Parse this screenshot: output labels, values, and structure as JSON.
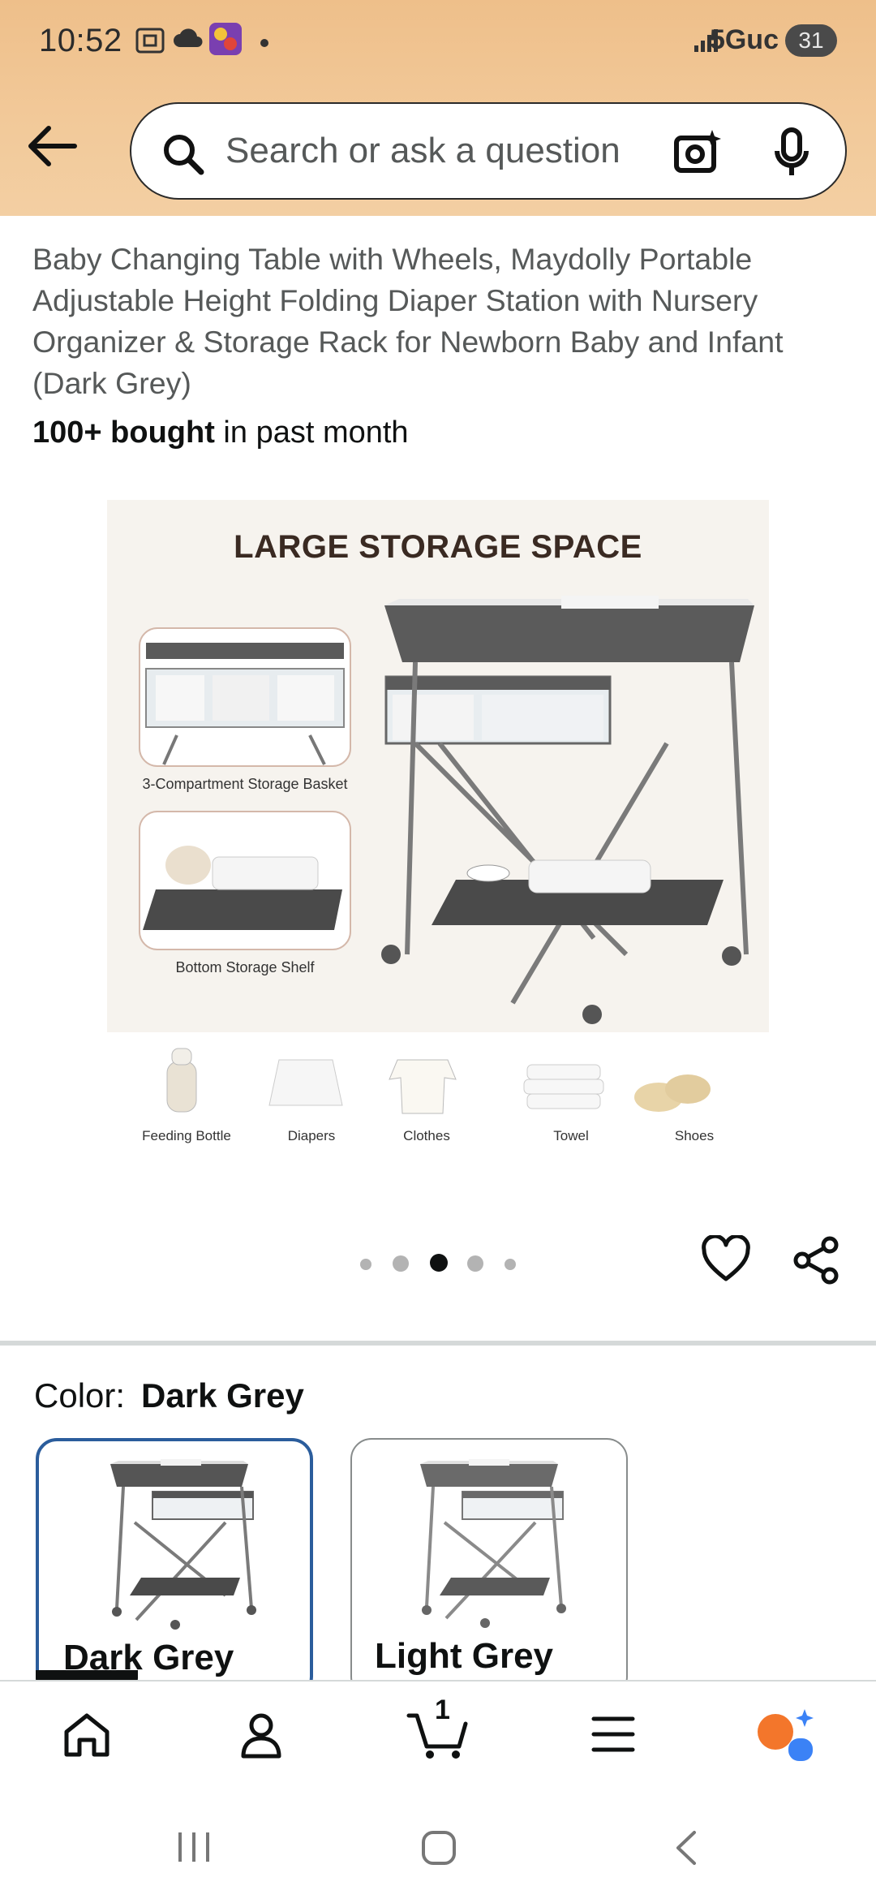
{
  "status_bar": {
    "time": "10:52",
    "network": "5Guc",
    "battery": "31"
  },
  "search": {
    "placeholder": "Search or ask a question"
  },
  "product": {
    "title": "Baby Changing Table with Wheels, Maydolly Portable Adjustable Height Folding Diaper Station with Nursery Organizer & Storage Rack for Newborn Baby and Infant (Dark Grey)",
    "bought_bold": "100+ bought",
    "bought_rest": " in past month"
  },
  "image": {
    "headline": "LARGE STORAGE SPACE",
    "inset_1": "3-Compartment Storage Basket",
    "inset_2": "Bottom Storage Shelf",
    "items": [
      "Feeding Bottle",
      "Diapers",
      "Clothes",
      "Towel",
      "Shoes"
    ]
  },
  "carousel": {
    "count": 5,
    "active_index": 2
  },
  "color": {
    "label": "Color:",
    "selected": "Dark Grey",
    "options": [
      "Dark Grey",
      "Light Grey"
    ]
  },
  "nav": {
    "cart_count": "1",
    "icons": [
      "home-icon",
      "account-icon",
      "cart-icon",
      "menu-icon",
      "rufus-icon"
    ]
  },
  "colors": {
    "header_bg": "#f2c999",
    "selected_border": "#2b5d9c",
    "text_dark": "#0f1111",
    "text_muted": "#565959"
  }
}
